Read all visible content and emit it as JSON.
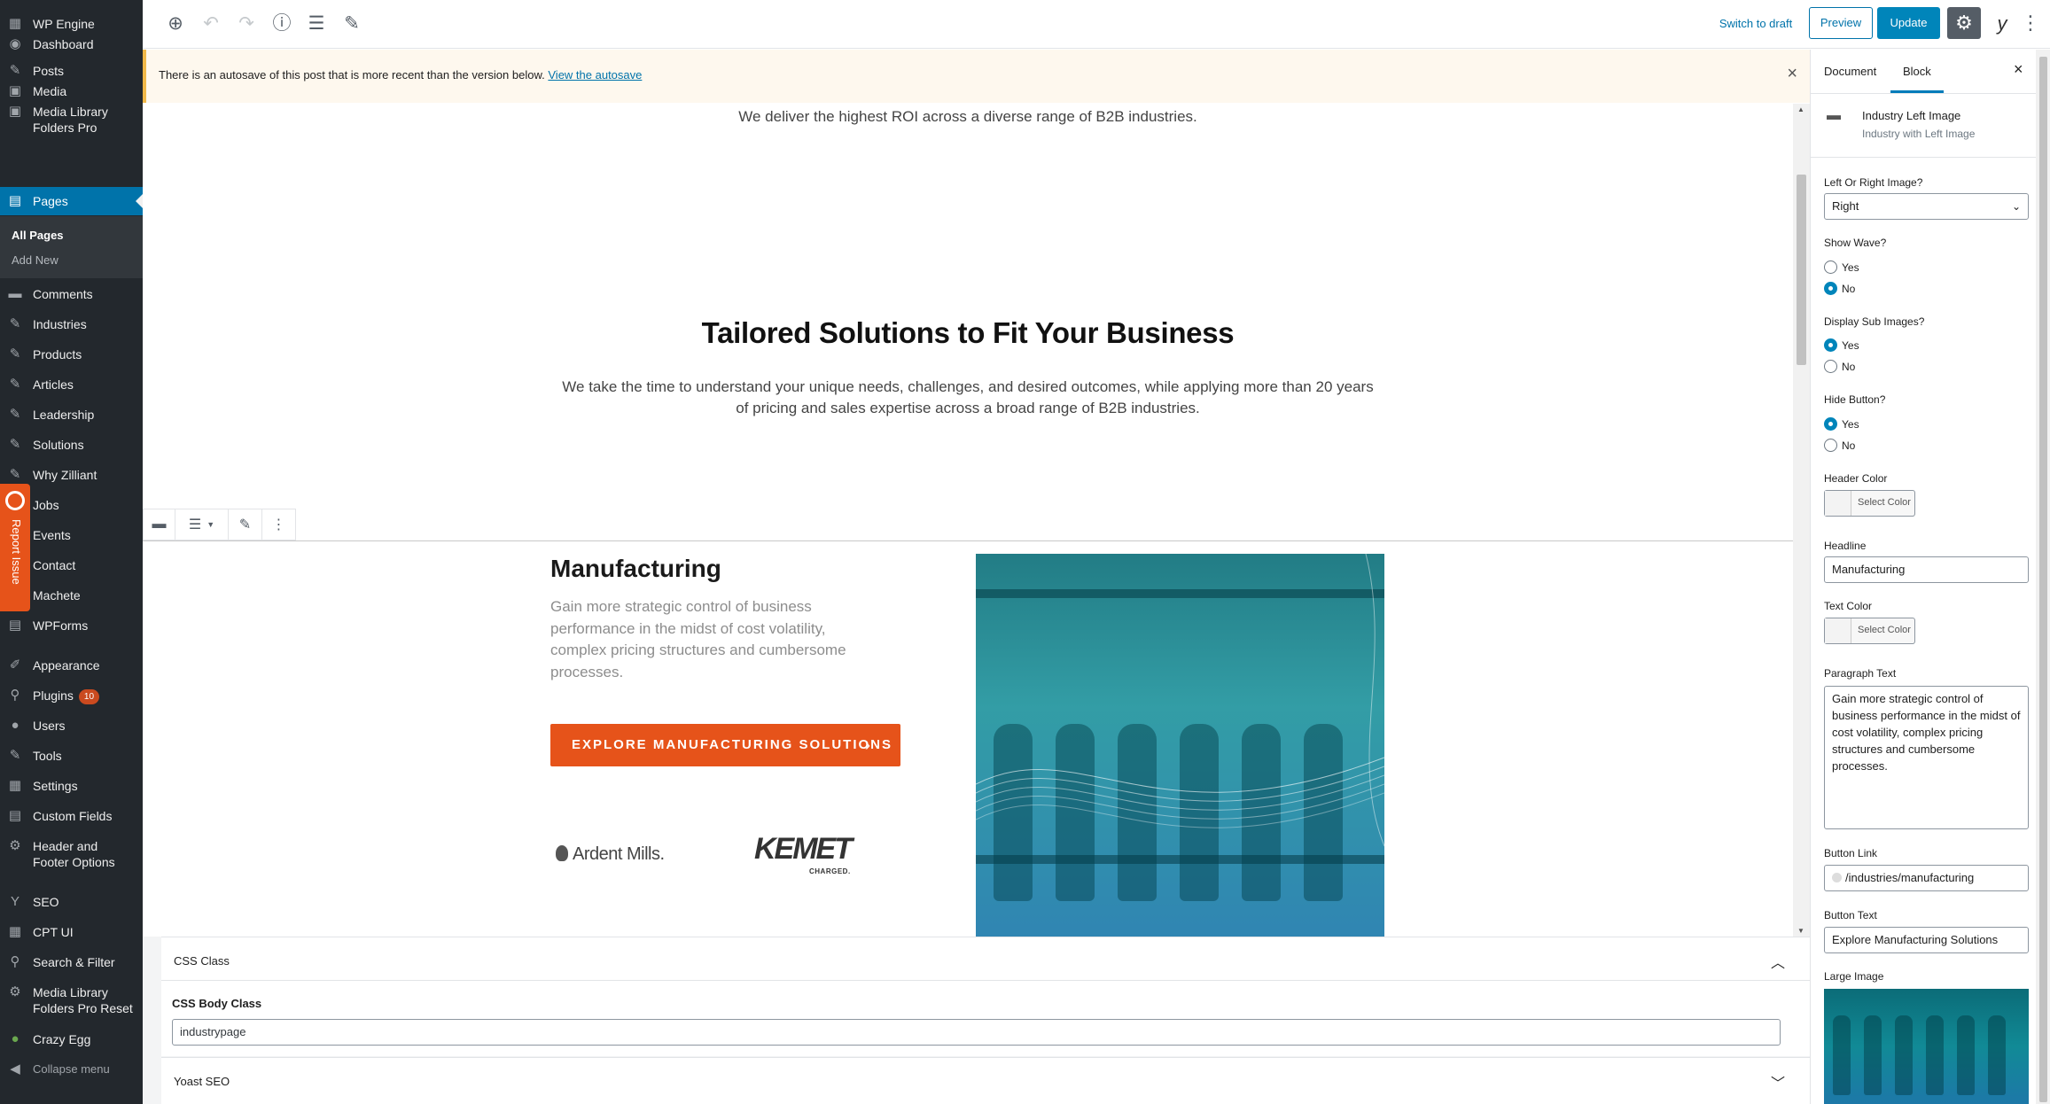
{
  "colors": {
    "admin_bg": "#23282d",
    "active": "#0073aa",
    "accent_orange": "#e6531a",
    "notice_border": "#f0b849"
  },
  "admin_menu": {
    "site": "WP Engine",
    "items": [
      {
        "label": "Dashboard",
        "icon": "dashboard-icon"
      },
      {
        "label": "Posts",
        "icon": "pin-icon"
      },
      {
        "label": "Media",
        "icon": "media-icon"
      },
      {
        "label": "Media Library Folders Pro",
        "icon": "media-icon"
      },
      {
        "label": "Pages",
        "icon": "pages-icon"
      },
      {
        "label": "Comments",
        "icon": "comment-icon"
      },
      {
        "label": "Industries",
        "icon": "pin-icon"
      },
      {
        "label": "Products",
        "icon": "pin-icon"
      },
      {
        "label": "Articles",
        "icon": "pin-icon"
      },
      {
        "label": "Leadership",
        "icon": "pin-icon"
      },
      {
        "label": "Solutions",
        "icon": "pin-icon"
      },
      {
        "label": "Why Zilliant",
        "icon": "pin-icon"
      },
      {
        "label": "Jobs",
        "icon": "pin-icon"
      },
      {
        "label": "Events",
        "icon": "pin-icon"
      },
      {
        "label": "Contact",
        "icon": "pin-icon"
      },
      {
        "label": "Machete",
        "icon": "pin-icon"
      },
      {
        "label": "WPForms",
        "icon": "forms-icon"
      },
      {
        "label": "Appearance",
        "icon": "brush-icon"
      },
      {
        "label": "Plugins",
        "icon": "plug-icon",
        "badge": "10"
      },
      {
        "label": "Users",
        "icon": "user-icon"
      },
      {
        "label": "Tools",
        "icon": "wrench-icon"
      },
      {
        "label": "Settings",
        "icon": "settings-icon"
      },
      {
        "label": "Custom Fields",
        "icon": "fields-icon"
      },
      {
        "label": "Header and Footer Options",
        "icon": "gear-icon"
      },
      {
        "label": "SEO",
        "icon": "yoast-icon"
      },
      {
        "label": "CPT UI",
        "icon": "grid-icon"
      },
      {
        "label": "Search & Filter",
        "icon": "search-icon"
      },
      {
        "label": "Media Library Folders Pro Reset",
        "icon": "gear-icon"
      },
      {
        "label": "Crazy Egg",
        "icon": "egg-icon"
      },
      {
        "label": "Collapse menu",
        "icon": "collapse-icon"
      }
    ],
    "pages_submenu": [
      "All Pages",
      "Add New"
    ],
    "report_issue": "Report Issue"
  },
  "toolbar": {
    "switch_to_draft": "Switch to draft",
    "preview": "Preview",
    "update": "Update"
  },
  "notice": {
    "text": "There is an autosave of this post that is more recent than the version below.",
    "link": "View the autosave"
  },
  "canvas": {
    "top_text": "We deliver the highest ROI across a diverse range of B2B industries.",
    "heading": "Tailored Solutions to Fit Your Business",
    "paragraph": "We take the time to understand your unique needs, challenges, and desired outcomes, while applying more than 20 years of pricing and sales expertise across a broad range of B2B industries.",
    "industry": {
      "headline": "Manufacturing",
      "text": "Gain more strategic control of business performance in the midst of cost volatility, complex pricing structures and cumbersome processes.",
      "button": "EXPLORE MANUFACTURING SOLUTIONS",
      "logos": [
        "Ardent Mills.",
        "KEMET"
      ],
      "logo_tagline": "CHARGED."
    }
  },
  "metaboxes": {
    "css_class_title": "CSS Class",
    "css_body_label": "CSS Body Class",
    "css_body_value": "industrypage",
    "yoast_title": "Yoast SEO"
  },
  "sidebar": {
    "tabs": [
      "Document",
      "Block"
    ],
    "block_title": "Industry Left Image",
    "block_desc": "Industry with Left Image",
    "fields": {
      "left_right_label": "Left Or Right Image?",
      "left_right_value": "Right",
      "show_wave_label": "Show Wave?",
      "display_sub_label": "Display Sub Images?",
      "hide_button_label": "Hide Button?",
      "yes": "Yes",
      "no": "No",
      "show_wave": "No",
      "display_sub": "Yes",
      "hide_button": "Yes",
      "header_color_label": "Header Color",
      "select_color": "Select Color",
      "headline_label": "Headline",
      "headline_value": "Manufacturing",
      "text_color_label": "Text Color",
      "paragraph_label": "Paragraph Text",
      "paragraph_value": "Gain more strategic control of business performance in the midst of cost volatility, complex pricing structures and cumbersome processes.",
      "button_link_label": "Button Link",
      "button_link_value": "/industries/manufacturing",
      "button_text_label": "Button Text",
      "button_text_value": "Explore Manufacturing Solutions",
      "large_image_label": "Large Image"
    }
  }
}
